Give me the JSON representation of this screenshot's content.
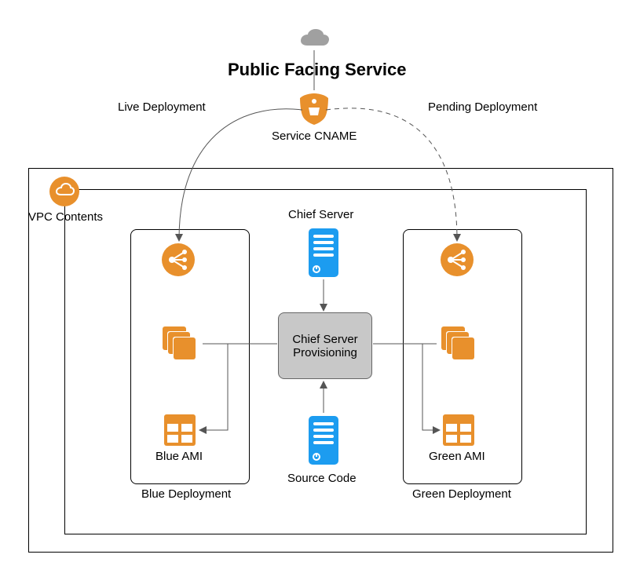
{
  "title": "Public Facing Service",
  "labels": {
    "live_deployment": "Live Deployment",
    "pending_deployment": "Pending Deployment",
    "service_cname": "Service CNAME",
    "vpc_contents": "VPC Contents",
    "chief_server": "Chief Server",
    "chief_server_provisioning": "Chief Server\nProvisioning",
    "source_code": "Source Code",
    "blue_ami": "Blue AMI",
    "green_ami": "Green AMI",
    "blue_deployment": "Blue Deployment",
    "green_deployment": "Green Deployment"
  },
  "colors": {
    "orange": "#e8902c",
    "blue": "#1c9cf0",
    "gray": "#a0a0a0",
    "box_gray": "#c8c8c8"
  }
}
